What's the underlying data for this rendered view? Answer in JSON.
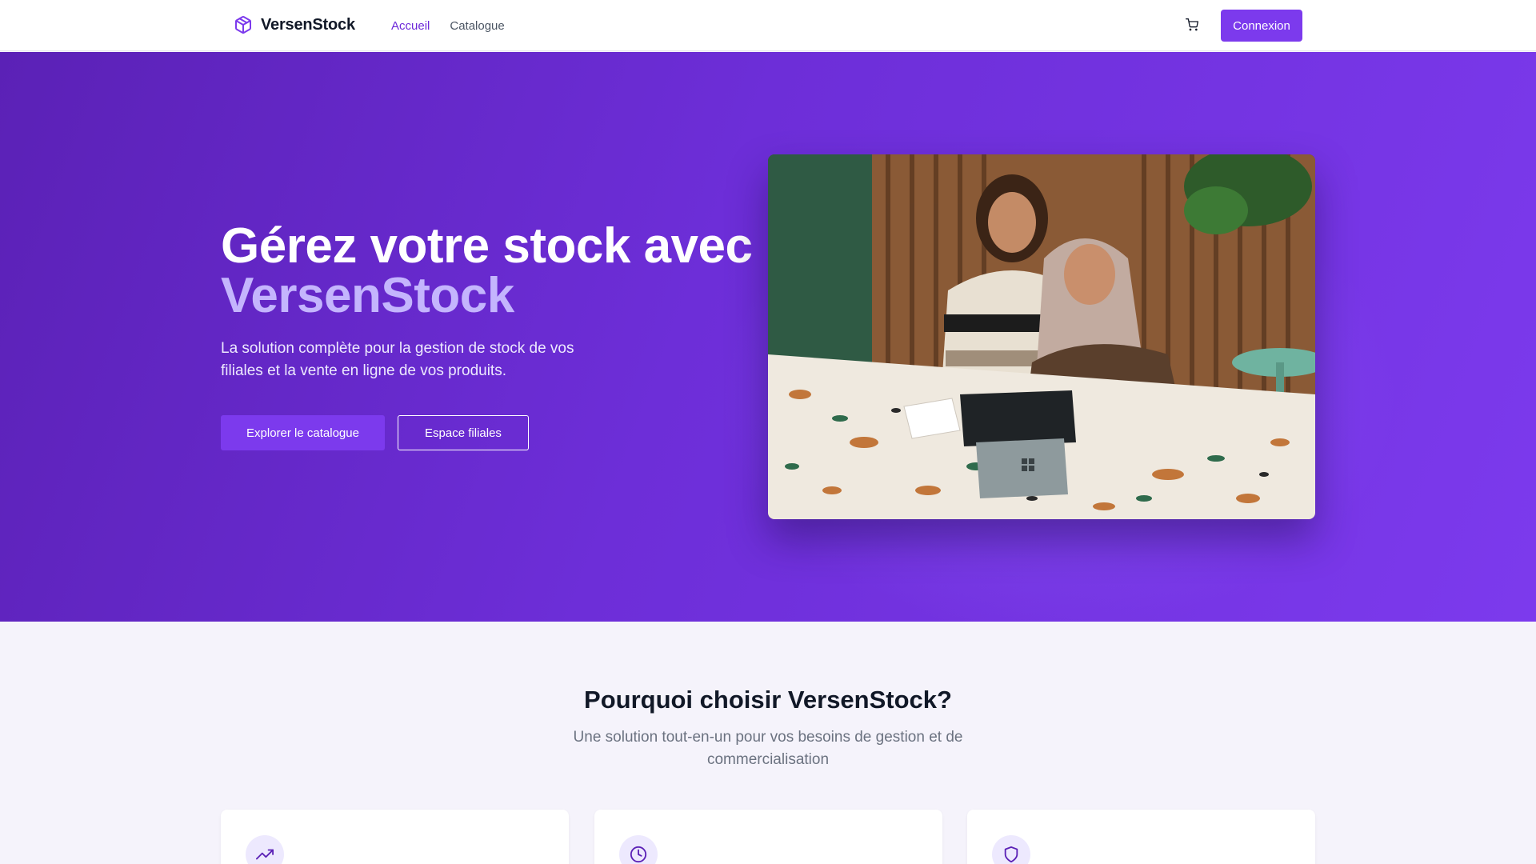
{
  "header": {
    "brand": "VersenStock",
    "logo_icon": "box-icon",
    "nav": [
      {
        "label": "Accueil",
        "active": true
      },
      {
        "label": "Catalogue",
        "active": false
      }
    ],
    "cart_icon": "cart-icon",
    "login_label": "Connexion"
  },
  "hero": {
    "title_line1": "Gérez votre stock avec",
    "title_line2": "VersenStock",
    "subtitle": "La solution complète pour la gestion de stock de vos filiales et la vente en ligne de vos produits.",
    "primary_cta": "Explorer le catalogue",
    "secondary_cta": "Espace filiales"
  },
  "features": {
    "title": "Pourquoi choisir VersenStock?",
    "subtitle": "Une solution tout-en-un pour vos besoins de gestion et de commercialisation",
    "cards": [
      {
        "icon": "trending-up-icon"
      },
      {
        "icon": "clock-icon"
      },
      {
        "icon": "shield-icon"
      }
    ]
  },
  "colors": {
    "brand": "#7c3aed",
    "brand_dark": "#5b21b6",
    "accent_text": "#c4b5fd"
  }
}
